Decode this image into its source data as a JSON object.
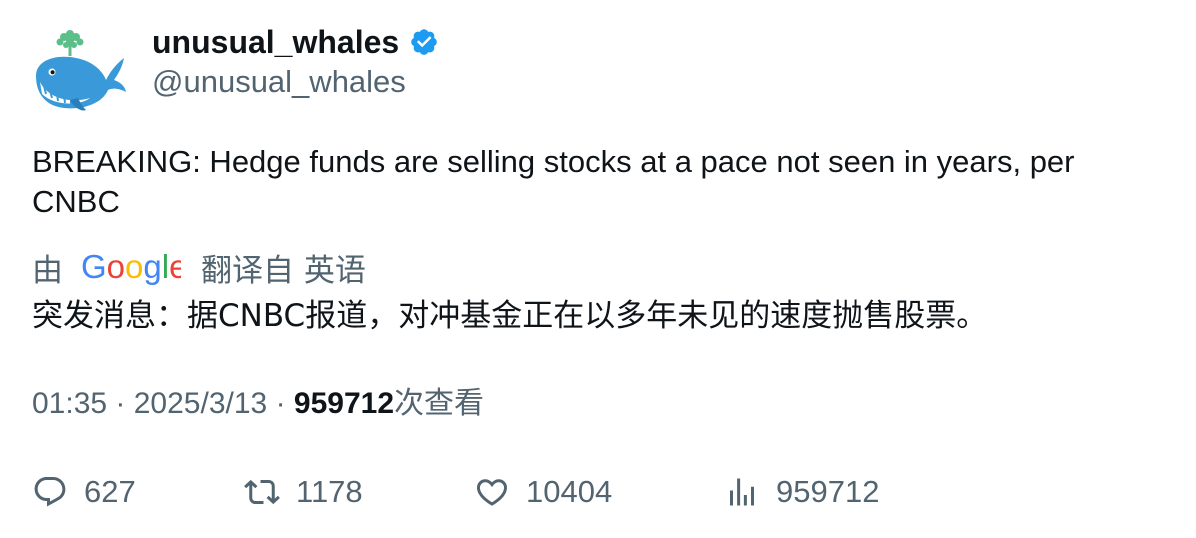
{
  "author": {
    "display_name": "unusual_whales",
    "handle": "@unusual_whales",
    "verified_icon": "verified-badge-icon",
    "avatar_icon": "whale-avatar"
  },
  "tweet": {
    "text": "BREAKING: Hedge funds are selling stocks at a pace not seen in years, per CNBC"
  },
  "translation": {
    "by_label": "由",
    "provider_logo": "Google",
    "from_label": "翻译自 英语",
    "text": "突发消息：据CNBC报道，对冲基金正在以多年未见的速度抛售股票。"
  },
  "meta": {
    "time": "01:35",
    "separator": "·",
    "date": "2025/3/13",
    "views_count": "959712",
    "views_label": "次查看"
  },
  "actions": {
    "replies": "627",
    "retweets": "1178",
    "likes": "10404",
    "views": "959712"
  },
  "colors": {
    "primary_text": "#0f1419",
    "secondary_text": "#536471",
    "verified": "#1d9bf0"
  }
}
